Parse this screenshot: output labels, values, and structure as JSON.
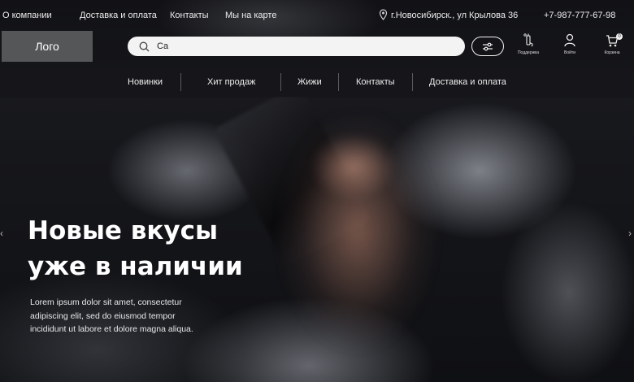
{
  "topbar": {
    "about": "О компании",
    "delivery": "Доставка и оплата",
    "contacts": "Контакты",
    "map": "Мы на карте",
    "address": "г.Новосибирск., ул Крылова 36",
    "phone": "+7-987-777-67-98"
  },
  "header": {
    "logo": "Лого",
    "search_value": "Ca",
    "support_label": "Поддержка",
    "login_label": "Войти",
    "cart_label": "Корзина",
    "cart_count": "0"
  },
  "nav": {
    "items": [
      "Новинки",
      "Хит продаж",
      "Жижи",
      "Контакты",
      "Доставка и оплата"
    ]
  },
  "hero": {
    "title_line1": "Новые вкусы",
    "title_line2": "уже в наличии",
    "desc_line1": "Lorem ipsum dolor sit amet, consectetur",
    "desc_line2": "adipiscing elit, sed do eiusmod tempor",
    "desc_line3": "incididunt ut labore et dolore magna aliqua."
  },
  "slider": {
    "prev": "‹",
    "next": "›"
  }
}
